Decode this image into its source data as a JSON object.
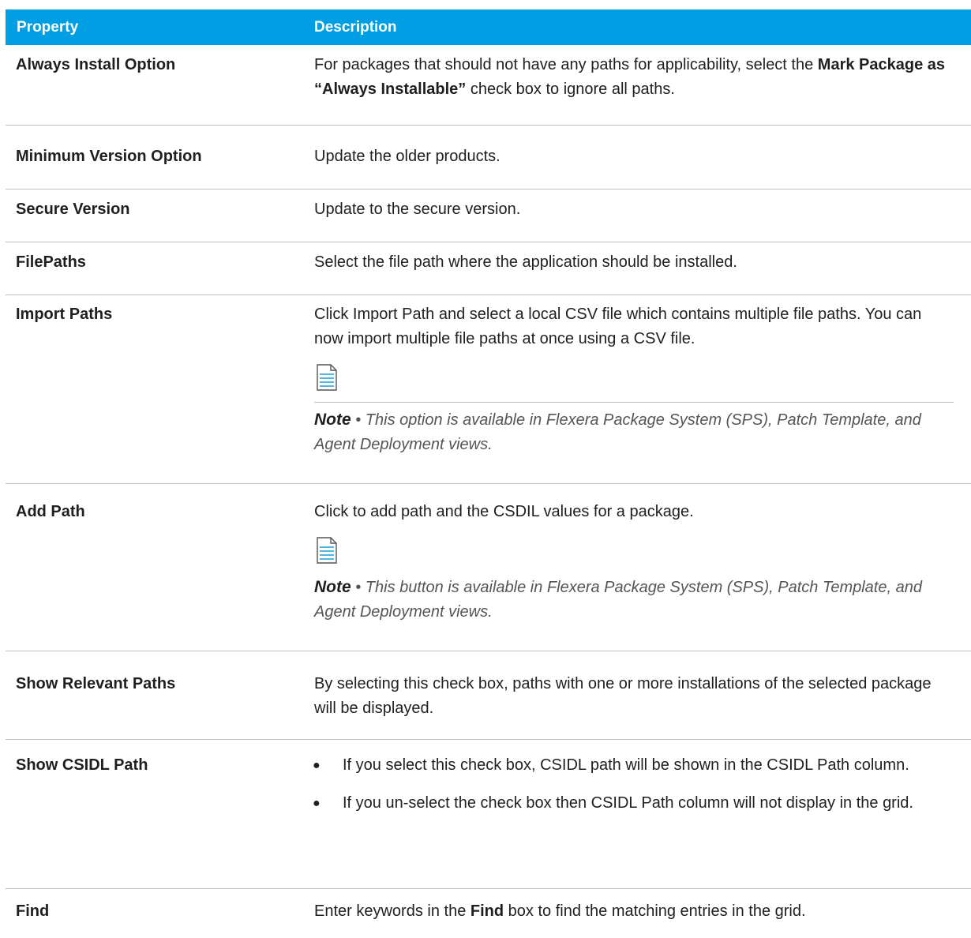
{
  "header": {
    "property": "Property",
    "description": "Description"
  },
  "rows": {
    "always_install": {
      "property": "Always Install Option",
      "desc_pre": "For packages that should not have any paths for applicability, select the ",
      "desc_bold": "Mark Package as “Always Installable”",
      "desc_post": " check box to ignore all paths."
    },
    "minimum_version": {
      "property": "Minimum Version Option",
      "desc": "Update the older products."
    },
    "secure_version": {
      "property": "Secure Version",
      "desc": "Update to the secure version."
    },
    "filepaths": {
      "property": "FilePaths",
      "desc": "Select the file path where the application should be installed."
    },
    "import_paths": {
      "property": "Import Paths",
      "desc": "Click Import Path and select a local CSV file which contains multiple file paths. You can now import multiple file paths at once using a CSV file.",
      "note_label": "Note",
      "note_text": " • This option is available in Flexera Package System (SPS), Patch Template, and Agent Deployment views."
    },
    "add_path": {
      "property": "Add Path",
      "desc": "Click to add path and the CSDIL values for a package.",
      "note_label": "Note",
      "note_text": " • This button is available in Flexera Package System (SPS), Patch Template, and Agent Deployment views."
    },
    "show_relevant": {
      "property": "Show Relevant Paths",
      "desc": "By selecting this check box, paths with one or more installations of the selected package will be displayed."
    },
    "show_csidl": {
      "property": "Show CSIDL Path",
      "bullets": [
        "If you select this check box, CSIDL path will be shown in the CSIDL Path column.",
        "If you un-select the check box then CSIDL Path column will not display in the grid."
      ]
    },
    "find": {
      "property": "Find",
      "desc_pre": "Enter keywords in the ",
      "desc_bold": "Find",
      "desc_post": " box to find the matching entries in the grid."
    }
  },
  "colors": {
    "header_bg": "#009fe3",
    "note_icon": "#1e9ad6"
  }
}
